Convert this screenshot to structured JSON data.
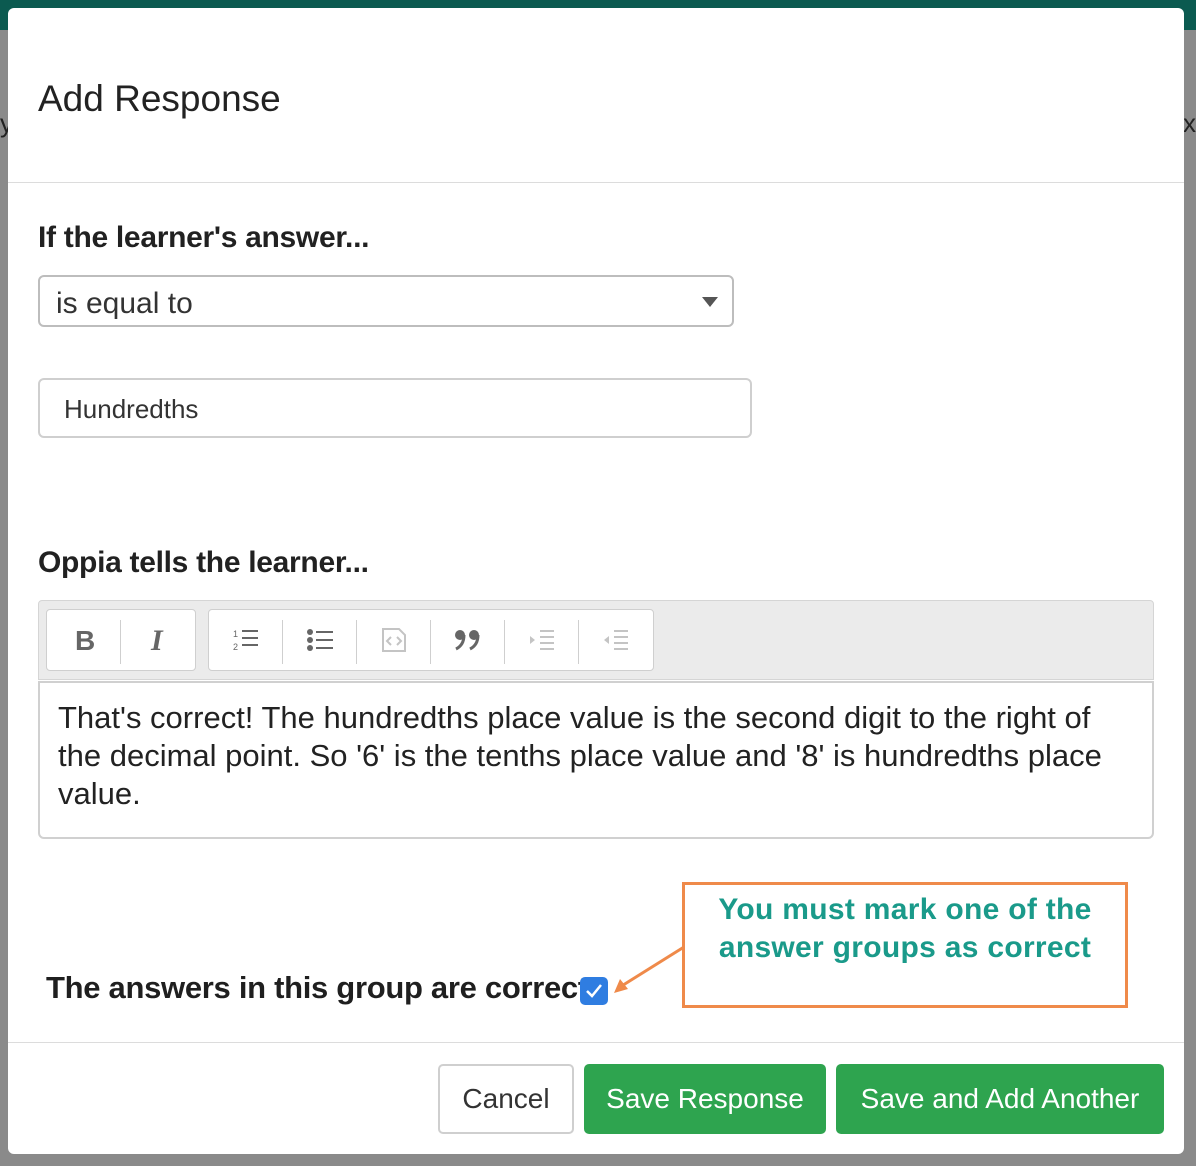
{
  "background": {
    "peek_left": "y",
    "peek_right": "x"
  },
  "modal": {
    "title": "Add Response"
  },
  "rule": {
    "label": "If the learner's answer...",
    "selected_rule": "is equal to",
    "input_value": "Hundredths"
  },
  "feedback": {
    "label": "Oppia tells the learner...",
    "toolbar": [
      {
        "name": "bold-icon",
        "glyph": "B"
      },
      {
        "name": "italic-icon",
        "glyph": "I"
      },
      {
        "name": "numbered-list-icon",
        "glyph": "≡"
      },
      {
        "name": "bulleted-list-icon",
        "glyph": "☰"
      },
      {
        "name": "code-block-icon",
        "glyph": "◇"
      },
      {
        "name": "blockquote-icon",
        "glyph": "❞"
      },
      {
        "name": "indent-icon",
        "glyph": "⇥"
      },
      {
        "name": "outdent-icon",
        "glyph": "⇤"
      }
    ],
    "text": "That's correct! The hundredths place value is the second digit to the right of the decimal point. So '6' is the tenths place value and '8' is hundredths place value."
  },
  "correctness": {
    "label": "The answers in this group are correct",
    "checked": true,
    "checkbox_color": "#2f7de1"
  },
  "annotation": {
    "text": "You must mark one of the answer groups as correct",
    "border_color": "#ef8a4a",
    "text_color": "#1a9a8a"
  },
  "footer": {
    "cancel_label": "Cancel",
    "save_label": "Save Response",
    "save_add_label": "Save and Add Another",
    "primary_color": "#2ea44f"
  }
}
